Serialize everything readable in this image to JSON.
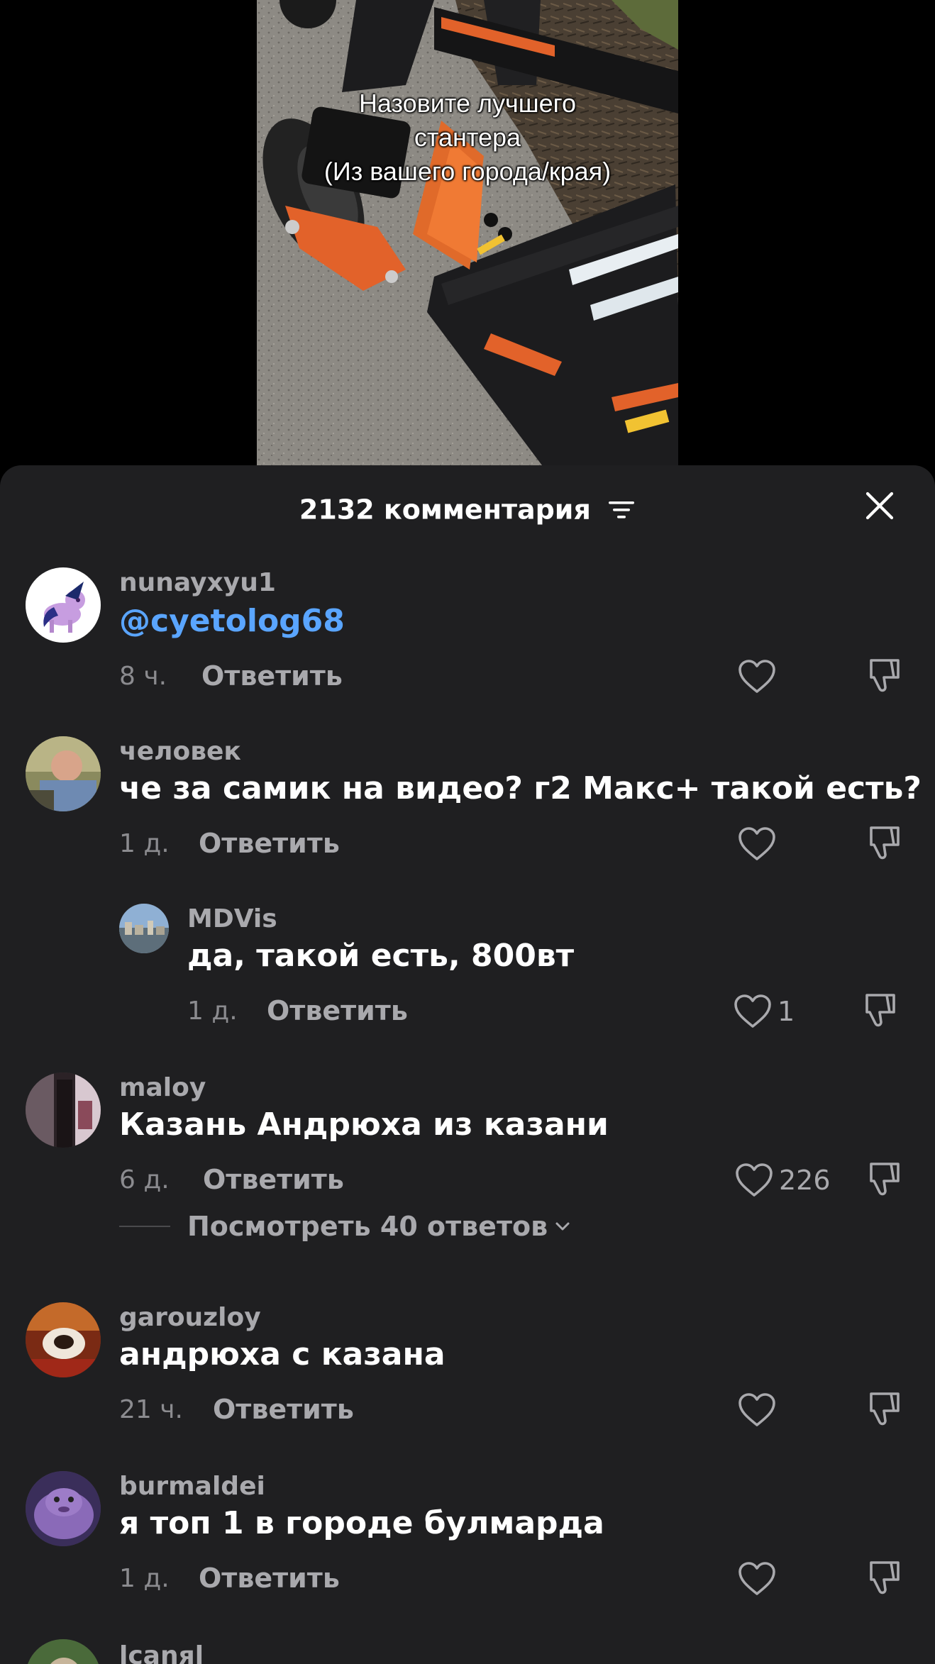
{
  "video": {
    "caption": "Назовите лучшего\nстантера\n(Из вашего города/края)"
  },
  "sheet": {
    "count_label": "2132 комментария",
    "sort_icon": "sort-lines-icon",
    "close_icon": "close-x-icon"
  },
  "comments": [
    {
      "username": "nunayxyu1",
      "text": "@cyetolog68",
      "time": "8 ч.",
      "reply": "Ответить",
      "likes": ""
    },
    {
      "username": "человек",
      "text": "че за самик на видео? г2 Макс+ такой есть?",
      "time": "1 д.",
      "reply": "Ответить",
      "likes": ""
    },
    {
      "username": "MDVis",
      "text": "да, такой есть, 800вт",
      "time": "1 д.",
      "reply": "Ответить",
      "likes": "1"
    },
    {
      "username": "maloy",
      "text": "Казань Андрюха из казани",
      "time": "6 д.",
      "reply": "Ответить",
      "likes": "226",
      "view_replies": "Посмотреть 40 ответов"
    },
    {
      "username": "garouzloy",
      "text": "андрюха с казана",
      "time": "21 ч.",
      "reply": "Ответить",
      "likes": ""
    },
    {
      "username": "burmaldei",
      "text": "я топ 1 в городе булмарда",
      "time": "1 д.",
      "reply": "Ответить",
      "likes": ""
    },
    {
      "username": "lcanяl"
    }
  ],
  "colors": {
    "sheet_bg": "#1f1f21",
    "mention": "#5aa5ff",
    "muted": "#a9a9ad"
  }
}
